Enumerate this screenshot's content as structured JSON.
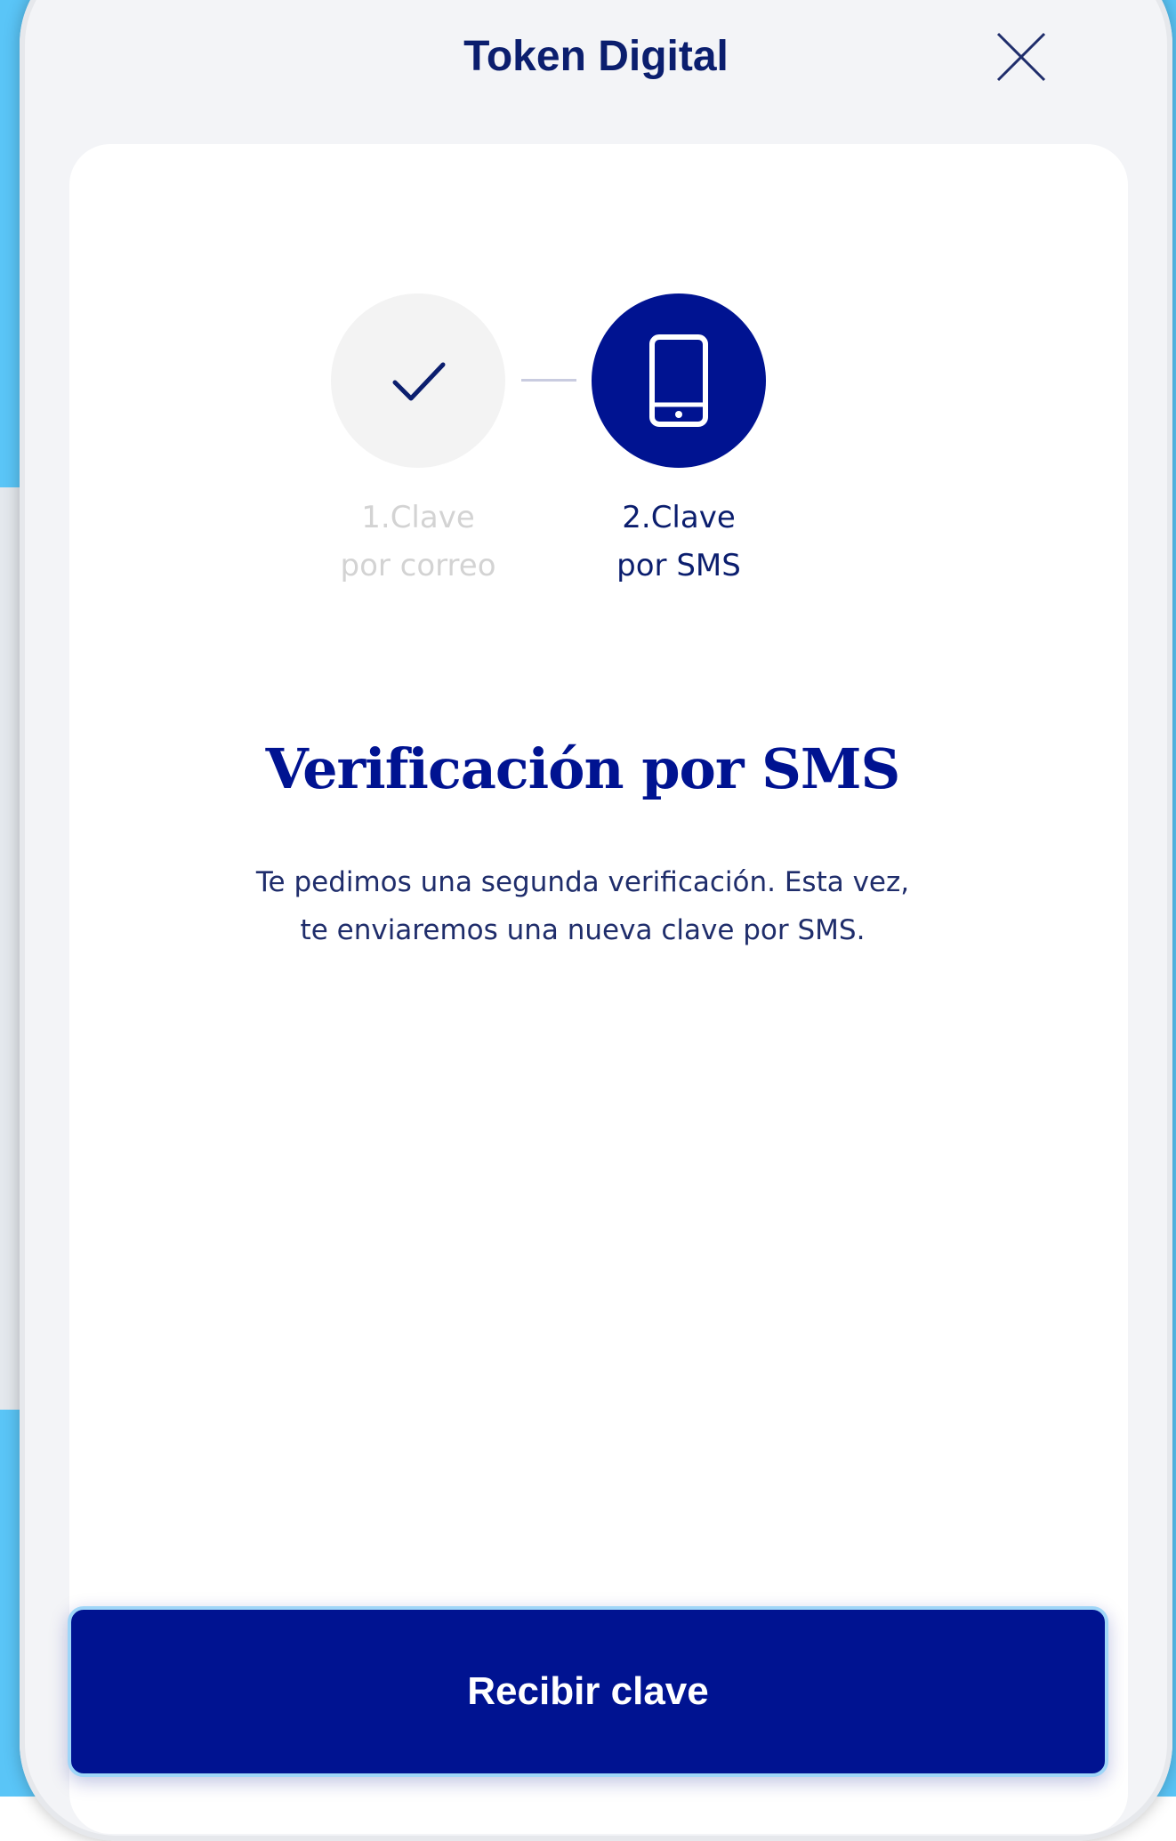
{
  "header": {
    "title": "Token Digital",
    "close_icon": "close-icon"
  },
  "stepper": {
    "steps": [
      {
        "line1": "1.Clave",
        "line2": "por correo",
        "icon": "checkmark-icon",
        "state": "completed"
      },
      {
        "line1": "2.Clave",
        "line2": "por SMS",
        "icon": "mobile-phone-icon",
        "state": "active"
      }
    ]
  },
  "content": {
    "title": "Verificación por SMS",
    "description_line1": "Te pedimos una segunda verificación. Esta vez,",
    "description_line2": "te enviaremos una nueva clave por SMS."
  },
  "footer": {
    "primary_button_label": "Recibir clave"
  },
  "colors": {
    "primary": "#001391",
    "text_dark": "#0b1e6e",
    "inactive_text": "#d3d3d3",
    "completed_bg": "#f3f3f3",
    "background_accent": "#5ac5f7"
  }
}
